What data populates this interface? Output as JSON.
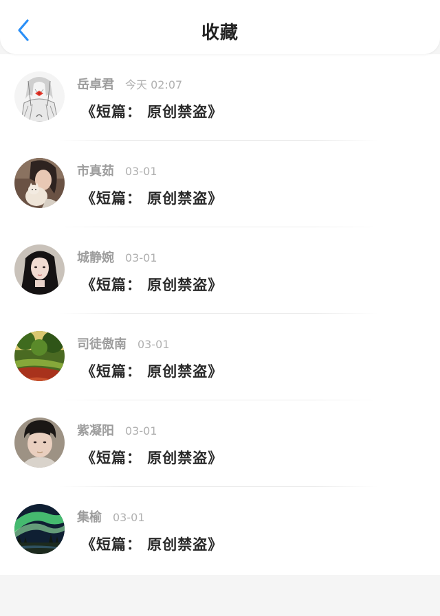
{
  "header": {
    "title": "收藏",
    "back_icon": "chevron-left-icon",
    "accent_color": "#2a8ff7"
  },
  "items": [
    {
      "author": "岳卓君",
      "time": "今天 02:07",
      "headline": "《短篇： 原创禁盗》",
      "avatar": "anime-girl-sketch"
    },
    {
      "author": "市真茹",
      "time": "03-01",
      "headline": "《短篇： 原创禁盗》",
      "avatar": "girl-with-cat-photo"
    },
    {
      "author": "城静婉",
      "time": "03-01",
      "headline": "《短篇： 原创禁盗》",
      "avatar": "girl-dark-hair-photo"
    },
    {
      "author": "司徒傲南",
      "time": "03-01",
      "headline": "《短篇： 原创禁盗》",
      "avatar": "forest-landscape-photo"
    },
    {
      "author": "紫凝阳",
      "time": "03-01",
      "headline": "《短篇： 原创禁盗》",
      "avatar": "man-portrait-photo"
    },
    {
      "author": "集榆",
      "time": "03-01",
      "headline": "《短篇： 原创禁盗》",
      "avatar": "aurora-night-photo"
    }
  ]
}
